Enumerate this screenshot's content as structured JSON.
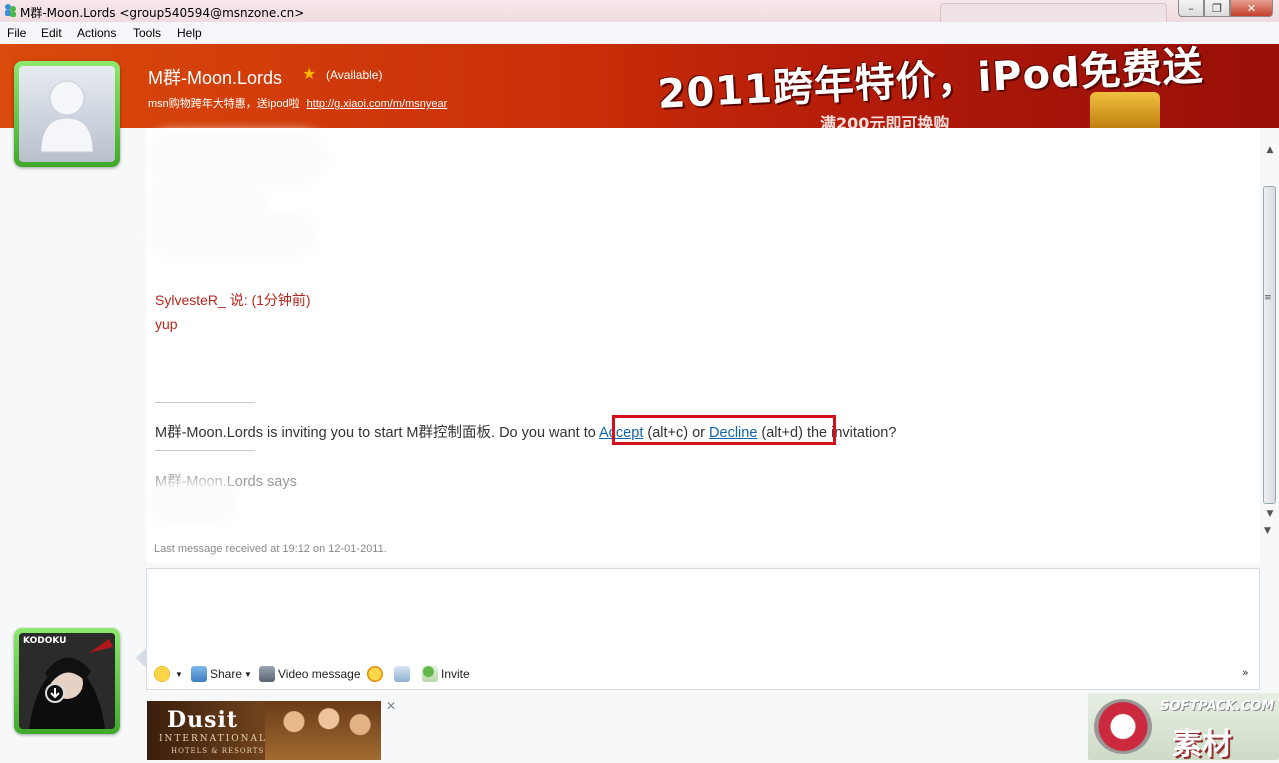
{
  "window": {
    "title": "M群-Moon.Lords <group540594@msnzone.cn>",
    "buttons": {
      "minimize": "–",
      "maximize": "❐",
      "close": "✕"
    }
  },
  "menu": [
    "File",
    "Edit",
    "Actions",
    "Tools",
    "Help"
  ],
  "banner": {
    "ad_text": "2011跨年特价，iPod免费送",
    "ad_sub": "满200元即可换购"
  },
  "contact": {
    "name": "M群-Moon.Lords",
    "status": "(Available)",
    "personal_message": "msn购物跨年大特惠，送ipod啦",
    "link": "http://g.xiaoi.com/m/msnyear"
  },
  "conversation": {
    "sender_line": "SylvesteR_ 说: (1分钟前)",
    "message": "yup",
    "invite": {
      "prefix": "M群-Moon.Lords is inviting you to start M群控制面板. Do you want to ",
      "accept": "Accept",
      "accept_key": " (alt+c) or ",
      "decline": "Decline",
      "suffix": " (alt+d) the invitation?"
    },
    "says_line": "M群-Moon.Lords says",
    "last_message": "Last message received at 19:12 on 12-01-2011."
  },
  "toolbar": {
    "share": "Share",
    "video_message": "Video message",
    "invite": "Invite",
    "expand": "»"
  },
  "user": {
    "avatar_text": "KODOKU"
  },
  "bottom_ad": {
    "brand": "Dusit",
    "line1": "INTERNATIONAL",
    "line2": "HOTELS & RESORTS",
    "close": "✕"
  },
  "watermark": {
    "text": "SOFTPACK.COM",
    "cn": "素材"
  },
  "colors": {
    "accent_red": "#d4101c",
    "sender_red": "#b8261c",
    "link_blue": "#1163a8",
    "banner_orange": "#d94a0c"
  }
}
